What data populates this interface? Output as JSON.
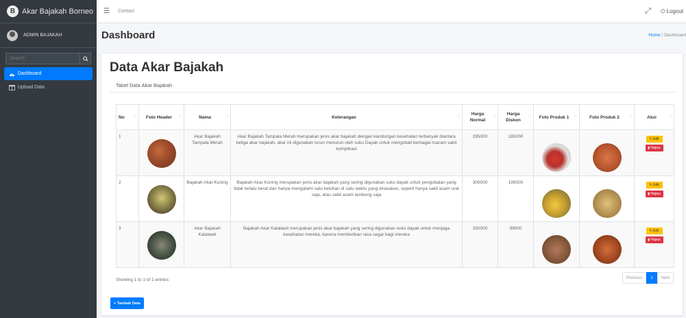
{
  "brand": {
    "name": "Akar Bajakah Borneo",
    "logo_letter": "B"
  },
  "user": {
    "name": "ADMIN BAJAKAH"
  },
  "search": {
    "placeholder": "Search"
  },
  "sidebar": {
    "items": [
      {
        "label": "Dashboard",
        "icon": "tachometer-icon",
        "active": true
      },
      {
        "label": "Upload Data",
        "icon": "table-icon",
        "active": false
      }
    ]
  },
  "topbar": {
    "contact_label": "Contact",
    "logout_label": "Logout"
  },
  "header": {
    "title": "Dashboard",
    "breadcrumb_home": "Home",
    "breadcrumb_sep": "/",
    "breadcrumb_current": "Dashboard"
  },
  "card": {
    "title": "Data Akar Bajakah",
    "subtitle": "Tabel Data Akar Bajakah"
  },
  "table": {
    "columns": [
      "No",
      "Foto Header",
      "Nama",
      "Keterangan",
      "Harga Normal",
      "Harga Diskon",
      "Foto Produk 1",
      "Foto Produk 2",
      "Aksi"
    ],
    "rows": [
      {
        "no": "1",
        "nama": "Akar Bajakah Tampala Merah",
        "keterangan": "Akar Bajakah Tampala Merah merupakan jenis akar bajakah dengan kandungan kesehatan terbanyak diantara ketiga akar bajakah, akar ini digunakan turun menurun oleh suku Dayak untuk mengobati berbagai macam sakit komplikasi",
        "harga_normal": "295000",
        "harga_diskon": "185000",
        "edit": "Edit",
        "hapus": "Hapus"
      },
      {
        "no": "2",
        "nama": "Bajakah Akar Kuning",
        "keterangan": "Bajakah Akar Kuning merupakan jenis akar bajakah yang sering digunakan suku dayak untuk pengobatan yang tidak terlalu berat dan hanya mengalami satu keluhan di satu waktu yang dirasakan, seperti hanya sakit asam urat saja, atau sakit asam lambung saja",
        "harga_normal": "300000",
        "harga_diskon": "195000",
        "edit": "Edit",
        "hapus": "Hapus"
      },
      {
        "no": "3",
        "nama": "Akar Bajakah Kalalawit",
        "keterangan": "Bajakah Akar Kalalawit merupakan jenis akar bajakah yang sering digunakan suku dayak untuk menjaga kesehatan mereka, karena memberikan rasa segar bagi mereka",
        "harga_normal": "250000",
        "harga_diskon": "99000",
        "edit": "Edit",
        "hapus": "Hapus"
      }
    ]
  },
  "footer": {
    "showing": "Showing 1 to 1 of 1 entries",
    "prev": "Previous",
    "page": "1",
    "next": "Next",
    "add_button": "+ Tambah Data"
  },
  "colors": {
    "primary": "#007bff",
    "sidebar": "#343a40",
    "edit": "#ffc107",
    "delete": "#dc3545"
  }
}
